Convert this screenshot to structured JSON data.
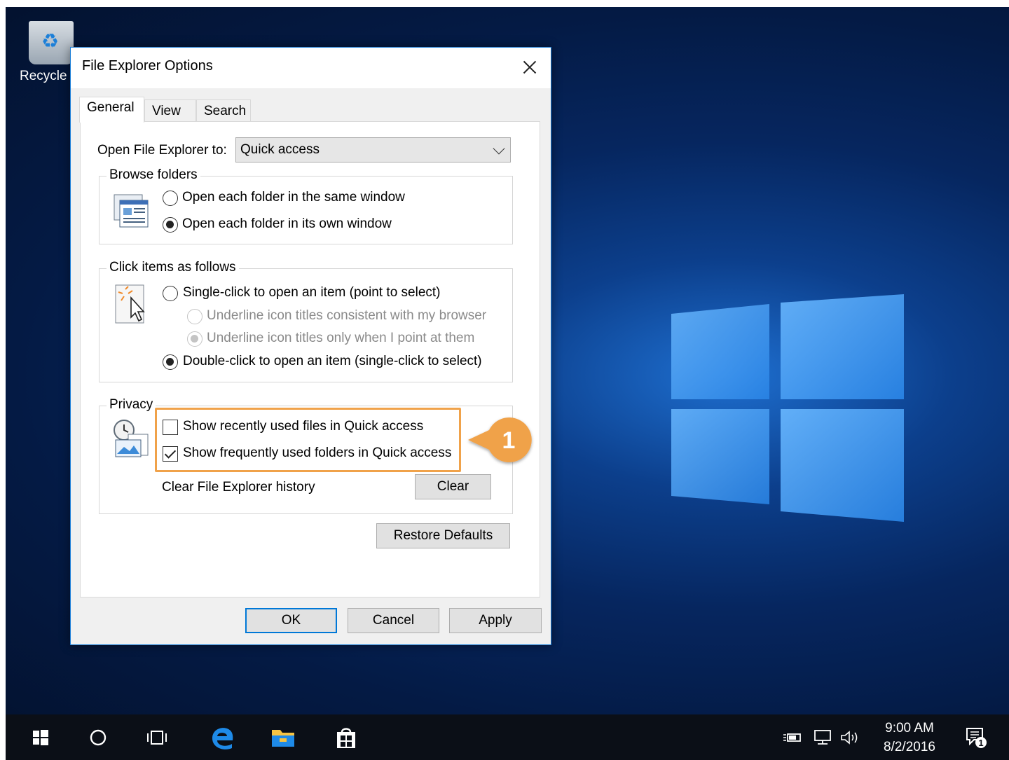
{
  "desktop": {
    "recycle_label": "Recycle"
  },
  "dialog": {
    "title": "File Explorer Options",
    "tabs": [
      {
        "label": "General",
        "active": true
      },
      {
        "label": "View",
        "active": false
      },
      {
        "label": "Search",
        "active": false
      }
    ],
    "open_to_label": "Open File Explorer to:",
    "open_to_value": "Quick access",
    "browse": {
      "title": "Browse folders",
      "same_window": "Open each folder in the same window",
      "own_window": "Open each folder in its own window",
      "selected": "own_window"
    },
    "click": {
      "title": "Click items as follows",
      "single_click": "Single-click to open an item (point to select)",
      "underline_browser": "Underline icon titles consistent with my browser",
      "underline_point": "Underline icon titles only when I point at them",
      "double_click": "Double-click to open an item (single-click to select)",
      "selected": "double_click"
    },
    "privacy": {
      "title": "Privacy",
      "recent_files": "Show recently used files in Quick access",
      "recent_files_checked": false,
      "frequent_folders": "Show frequently used folders in Quick access",
      "frequent_folders_checked": true,
      "clear_history_label": "Clear File Explorer history",
      "clear_button": "Clear"
    },
    "restore_defaults": "Restore Defaults",
    "ok": "OK",
    "cancel": "Cancel",
    "apply": "Apply"
  },
  "callout": {
    "number": "1",
    "color": "#f0a24a"
  },
  "taskbar": {
    "icons": [
      "start-icon",
      "cortana-icon",
      "task-view-icon",
      "edge-icon",
      "file-explorer-icon",
      "store-icon"
    ],
    "tray_icons": [
      "power-icon",
      "network-icon",
      "volume-icon",
      "notification-icon"
    ],
    "time": "9:00 AM",
    "date": "8/2/2016",
    "notification_count": "1"
  }
}
